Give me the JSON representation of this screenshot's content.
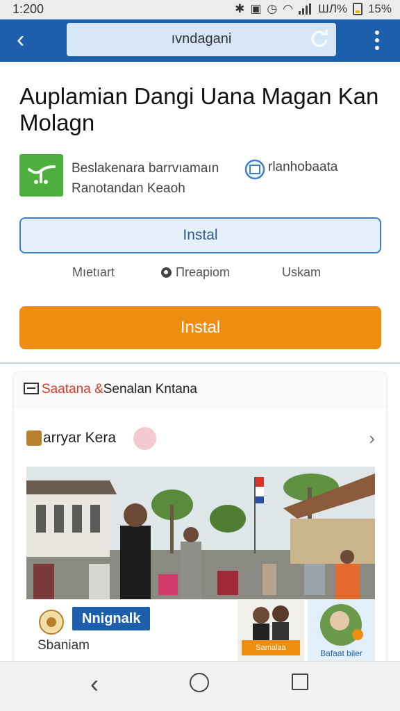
{
  "status_bar": {
    "time": "1:200",
    "battery_percent": "15%",
    "secondary_percent": "ШЛ%",
    "icons": [
      "bluetooth-icon",
      "nfc-icon",
      "alarm-icon",
      "wifi-icon",
      "signal-icon",
      "battery-icon"
    ]
  },
  "app_bar": {
    "url": "ıvndagani",
    "color": "#1e5fad",
    "icons": [
      "back-arrow-icon",
      "reload-icon",
      "more-vert-icon"
    ]
  },
  "app": {
    "title": "Auplamian Dangi Uana Magan Kan Molagn",
    "developer_line1": "Beslakenara barrvıamaın",
    "developer_line2": "Ranotandan Keaoh",
    "badge_text": "rlanhobaata",
    "icon_color": "#4caf3e"
  },
  "buttons": {
    "install_secondary": "Instal",
    "install_primary": "Instal",
    "primary_color": "#ed8d12"
  },
  "meta": {
    "item1": "Mıetıart",
    "item2": "Πreapiom",
    "item3": "Uskam"
  },
  "card": {
    "header_red": "Saatana &",
    "header_black": "Senalan Kntana",
    "section_title": "arryar Kera",
    "blue_label": "Nnignalk",
    "strip_label": "Sbaniam",
    "thumb1_label": "Samalaa",
    "thumb2_label": "Bafaat biler"
  },
  "nav_bar": {
    "icons": [
      "nav-back-icon",
      "nav-home-icon",
      "nav-recents-icon"
    ]
  }
}
